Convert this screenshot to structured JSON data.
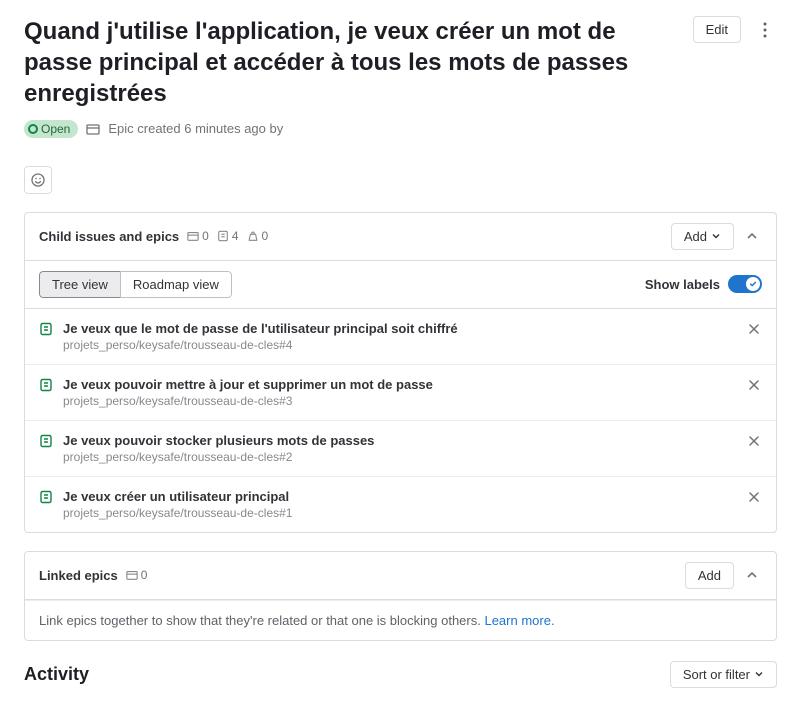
{
  "header": {
    "title": "Quand j'utilise l'application, je veux créer un mot de passe principal et accéder à tous les mots de passes enregistrées",
    "edit_label": "Edit"
  },
  "meta": {
    "status": "Open",
    "line": "Epic created 6 minutes ago by"
  },
  "children": {
    "label": "Child issues and epics",
    "counts": {
      "epics": "0",
      "issues": "4",
      "weight": "0"
    },
    "add_label": "Add",
    "views": {
      "tree": "Tree view",
      "roadmap": "Roadmap view"
    },
    "show_labels": "Show labels",
    "items": [
      {
        "title": "Je veux que le mot de passe de l'utilisateur principal soit chiffré",
        "ref": "projets_perso/keysafe/trousseau-de-cles#4"
      },
      {
        "title": "Je veux pouvoir mettre à jour et supprimer un mot de passe",
        "ref": "projets_perso/keysafe/trousseau-de-cles#3"
      },
      {
        "title": "Je veux pouvoir stocker plusieurs mots de passes",
        "ref": "projets_perso/keysafe/trousseau-de-cles#2"
      },
      {
        "title": "Je veux créer un utilisateur principal",
        "ref": "projets_perso/keysafe/trousseau-de-cles#1"
      }
    ]
  },
  "linked": {
    "label": "Linked epics",
    "count": "0",
    "add_label": "Add",
    "hint": "Link epics together to show that they're related or that one is blocking others. ",
    "learn": "Learn more."
  },
  "activity": {
    "label": "Activity",
    "sort_label": "Sort or filter"
  }
}
